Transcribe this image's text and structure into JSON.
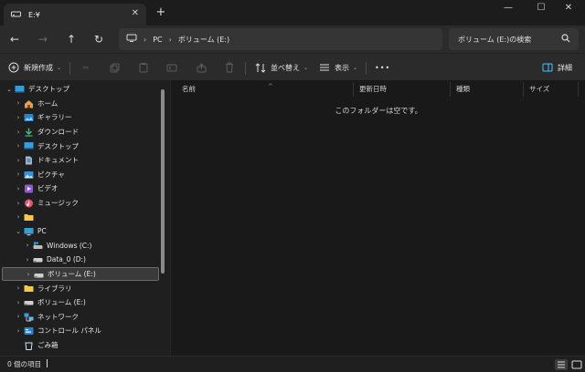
{
  "tab": {
    "title": "E:¥",
    "icon": "drive-icon",
    "close": "✕",
    "new": "+"
  },
  "window": {
    "minimize": "—",
    "maximize": "☐",
    "close": "✕"
  },
  "address": {
    "segments": [
      "PC",
      "ボリューム (E:)"
    ]
  },
  "search": {
    "placeholder": "ボリューム (E:)の検索"
  },
  "command_bar": {
    "new": "新規作成",
    "sort": "並べ替え",
    "view": "表示",
    "more": "•••",
    "details": "詳細"
  },
  "sidebar": {
    "items": [
      {
        "label": "デスクトップ",
        "icon": "desktop-icon",
        "expanded": true,
        "level": 0
      },
      {
        "label": "ホーム",
        "icon": "home-icon",
        "level": 1
      },
      {
        "label": "ギャラリー",
        "icon": "gallery-icon",
        "level": 1
      },
      {
        "label": "ダウンロード",
        "icon": "download-icon",
        "level": 1
      },
      {
        "label": "デスクトップ",
        "icon": "desktop-icon",
        "level": 1
      },
      {
        "label": "ドキュメント",
        "icon": "document-icon",
        "level": 1
      },
      {
        "label": "ピクチャ",
        "icon": "pictures-icon",
        "level": 1
      },
      {
        "label": "ビデオ",
        "icon": "video-icon",
        "level": 1
      },
      {
        "label": "ミュージック",
        "icon": "music-icon",
        "level": 1
      },
      {
        "label": "",
        "icon": "folder-icon",
        "level": 1
      },
      {
        "label": "PC",
        "icon": "pc-icon",
        "expanded": true,
        "level": 1
      },
      {
        "label": "Windows (C:)",
        "icon": "windows-drive-icon",
        "level": 2
      },
      {
        "label": "Data_0 (D:)",
        "icon": "drive-icon",
        "level": 2
      },
      {
        "label": "ボリューム (E:)",
        "icon": "drive-icon",
        "level": 2,
        "selected": true
      },
      {
        "label": "ライブラリ",
        "icon": "folder-icon",
        "level": 1
      },
      {
        "label": "ボリューム (E:)",
        "icon": "drive-icon",
        "level": 1
      },
      {
        "label": "ネットワーク",
        "icon": "network-icon",
        "level": 1
      },
      {
        "label": "コントロール パネル",
        "icon": "control-panel-icon",
        "level": 1
      },
      {
        "label": "ごみ箱",
        "icon": "recycle-bin-icon",
        "level": 1,
        "no_chevron": true
      }
    ]
  },
  "columns": [
    "名前",
    "更新日時",
    "種類",
    "サイズ"
  ],
  "empty_message": "このフォルダーは空です。",
  "status": {
    "count": "0 個の項目"
  },
  "colors": {
    "accent": "#4cc2ff",
    "folder": "#f2c94c"
  }
}
